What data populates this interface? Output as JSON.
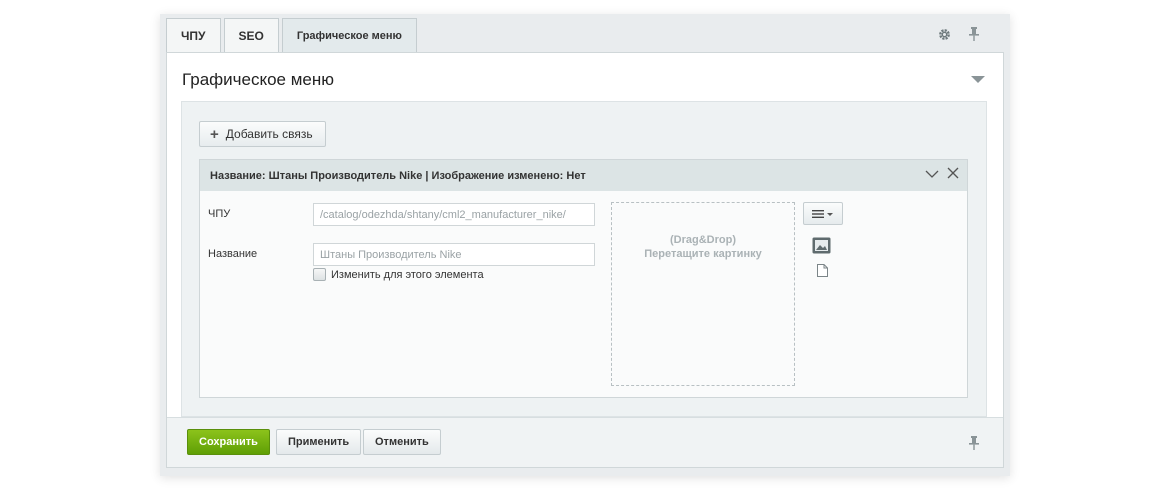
{
  "tabs": [
    {
      "label": "ЧПУ"
    },
    {
      "label": "SEO"
    },
    {
      "label": "Графическое меню"
    }
  ],
  "panel": {
    "title": "Графическое меню"
  },
  "add_button": {
    "label": "Добавить связь"
  },
  "item": {
    "header": "Название: Штаны Производитель Nike | Изображение изменено: Нет",
    "chpu_label": "ЧПУ",
    "chpu_value": "/catalog/odezhda/shtany/cml2_manufacturer_nike/",
    "name_label": "Название",
    "name_placeholder": "Штаны Производитель Nike",
    "checkbox_label": "Изменить для этого элемента",
    "drop_line1": "(Drag&Drop)",
    "drop_line2": "Перетащите картинку"
  },
  "footer": {
    "save": "Сохранить",
    "apply": "Применить",
    "cancel": "Отменить"
  },
  "colors": {
    "save_button": "#6aab0c",
    "header_bg": "#dce4e5",
    "background": "#e9ecee"
  },
  "icons": [
    "gear-icon",
    "pin-icon",
    "collapse-arrow-icon",
    "plus-icon",
    "chevron-down-icon",
    "close-icon",
    "menu-icon",
    "image-icon",
    "file-icon"
  ]
}
